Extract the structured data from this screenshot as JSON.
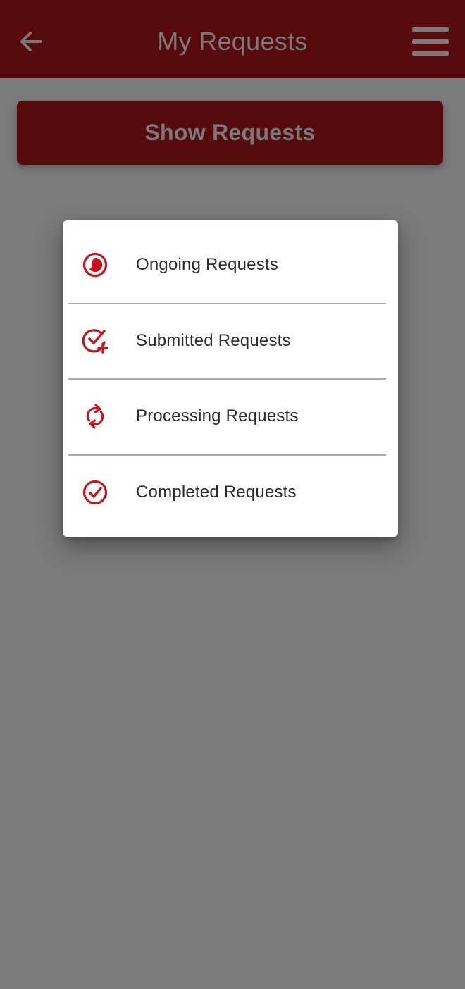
{
  "header": {
    "title": "My Requests",
    "back_icon": "arrow-left-icon",
    "menu_icon": "hamburger-menu-icon"
  },
  "show_requests_button": {
    "label": "Show Requests"
  },
  "popup_menu": {
    "items": [
      {
        "label": "Ongoing Requests",
        "icon": "clock-half-icon"
      },
      {
        "label": "Submitted Requests",
        "icon": "check-plus-icon"
      },
      {
        "label": "Processing Requests",
        "icon": "refresh-arrows-icon"
      },
      {
        "label": "Completed Requests",
        "icon": "check-circle-icon"
      }
    ]
  },
  "colors": {
    "brand_dark_red": "#560a0c",
    "icon_red": "#c5161d",
    "overlay_gray": "#7b7b7b",
    "popup_bg": "#ffffff"
  }
}
